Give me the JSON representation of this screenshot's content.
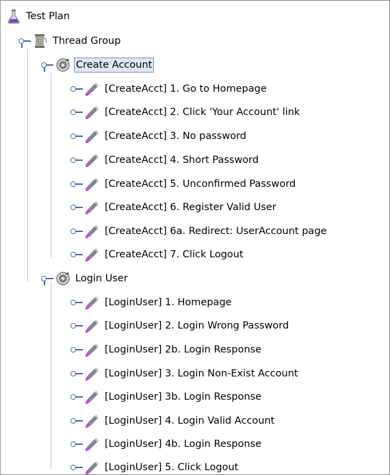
{
  "tree": {
    "root": {
      "label": "Test Plan",
      "icon": "flask-icon"
    },
    "thread_group": {
      "label": "Thread Group",
      "icon": "spool-icon"
    },
    "controllers": [
      {
        "label": "Create Account",
        "icon": "controller-icon",
        "selected": true,
        "samplers": [
          "[CreateAcct] 1. Go to Homepage",
          "[CreateAcct] 2. Click 'Your Account' link",
          "[CreateAcct] 3. No password",
          "[CreateAcct] 4. Short Password",
          "[CreateAcct] 5. Unconfirmed Password",
          "[CreateAcct] 6. Register Valid User",
          "[CreateAcct] 6a. Redirect: UserAccount page",
          "[CreateAcct] 7. Click Logout"
        ]
      },
      {
        "label": "Login User",
        "icon": "controller-icon",
        "selected": false,
        "samplers": [
          "[LoginUser] 1. Homepage",
          "[LoginUser] 2. Login Wrong Password",
          "[LoginUser] 2b. Login Response",
          "[LoginUser] 3. Login Non-Exist Account",
          "[LoginUser] 3b. Login Response",
          "[LoginUser] 4. Login Valid Account",
          "[LoginUser] 4b. Login Response",
          "[LoginUser] 5. Click Logout"
        ]
      }
    ],
    "sampler_icon": "pipette-icon",
    "colors": {
      "selection_bg": "#dde8f5",
      "selection_border": "#7895bd",
      "handle": "#3e6ea6",
      "guide_line": "#b9c6d6"
    }
  }
}
